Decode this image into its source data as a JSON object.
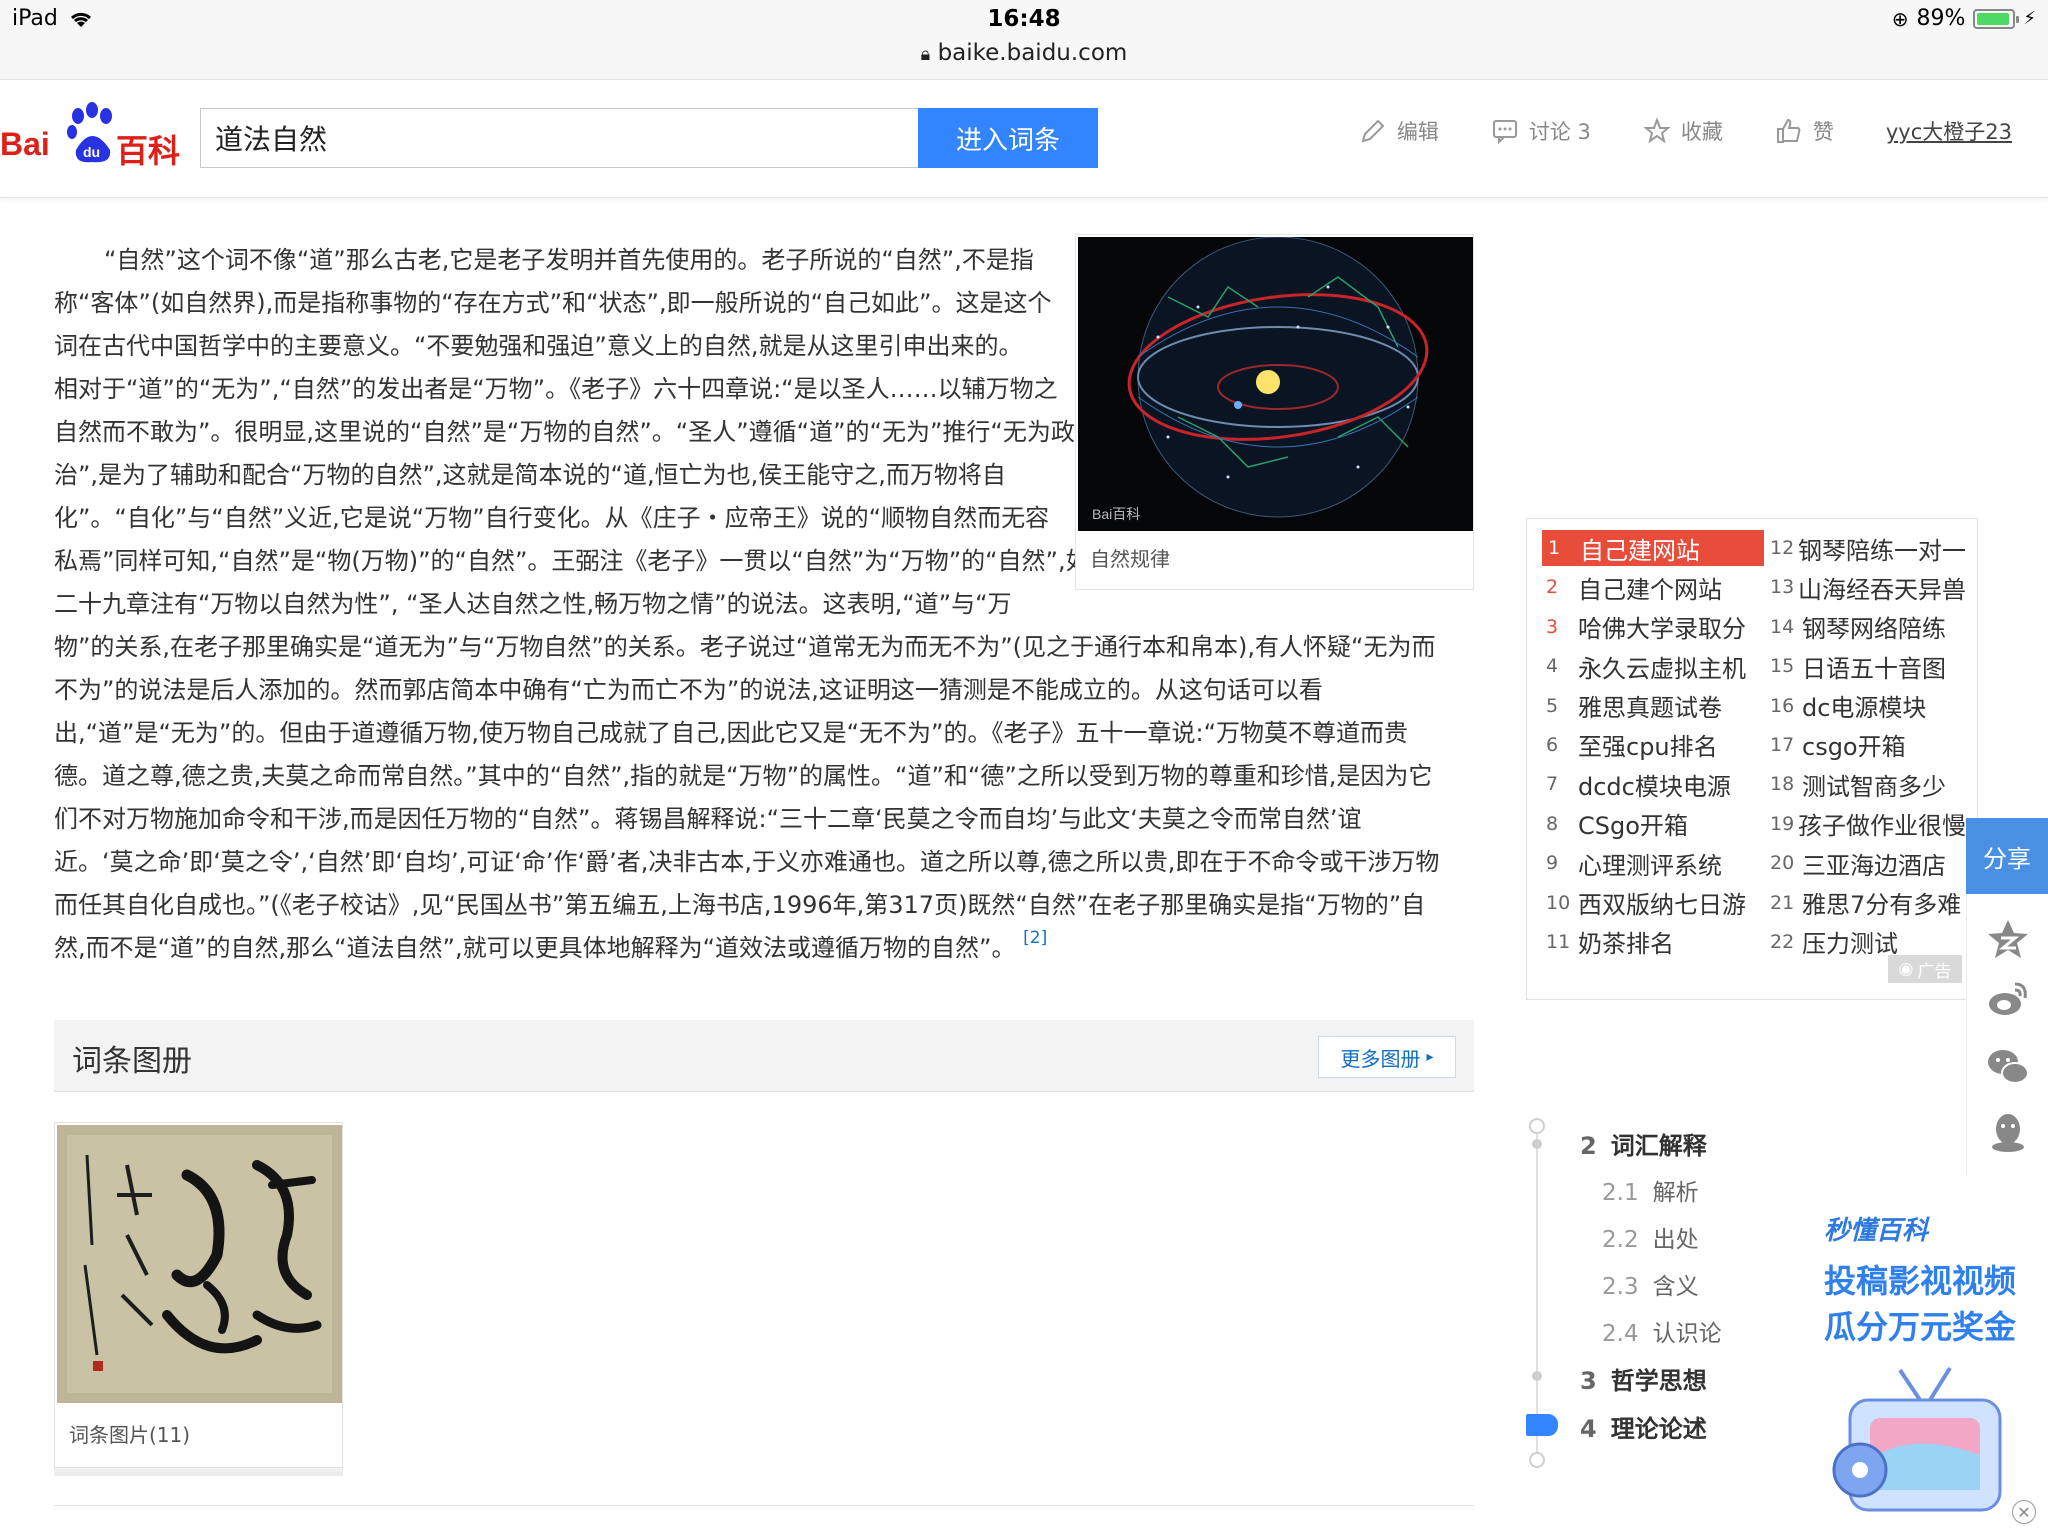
{
  "status": {
    "device": "iPad",
    "time": "16:48",
    "battery": "89%",
    "url": "baike.baidu.com"
  },
  "header": {
    "logo_bai": "Bai",
    "logo_du": "du",
    "logo_baike": "百科",
    "search_value": "道法自然",
    "search_button": "进入词条",
    "edit": "编辑",
    "discuss": "讨论 3",
    "collect": "收藏",
    "like": "赞",
    "user": "yyc大橙子23"
  },
  "article": {
    "lines": [
      "“自然”这个词不像“道”那么古老,它是老子发明并首先使用的。老子所说的“自然”,不是指",
      "称“客体”(如自然界),而是指称事物的“存在方式”和“状态”,即一般所说的“自己如此”。这是这个",
      "词在古代中国哲学中的主要意义。“不要勉强和强迫”意义上的自然,就是从这里引申出来的。",
      "相对于“道”的“无为”,“自然”的发出者是“万物”。《老子》六十四章说:“是以圣人……以辅万物之",
      "自然而不敢为”。很明显,这里说的“自然”是“万物的自然”。“圣人”遵循“道”的“无为”推行“无为政",
      "治”,是为了辅助和配合“万物的自然”,这就是简本说的“道,恒亡为也,侯王能守之,而万物将自",
      "化”。“自化”与“自然”义近,它是说“万物”自行变化。从《庄子・应帝王》说的“顺物自然而无容",
      "私焉”同样可知,“自然”是“物(万物)”的“自然”。王弼注《老子》一贯以“自然”为“万物”的“自然”,如",
      "二十九章注有“万物以自然为性”, “圣人达自然之性,畅万物之情”的说法。这表明,“道”与“万",
      "物”的关系,在老子那里确实是“道无为”与“万物自然”的关系。老子说过“道常无为而无不为”(见之于通行本和帛本),有人怀疑“无为而",
      "不为”的说法是后人添加的。然而郭店简本中确有“亡为而亡不为”的说法,这证明这一猜测是不能成立的。从这句话可以看",
      "出,“道”是“无为”的。但由于道遵循万物,使万物自己成就了自己,因此它又是“无不为”的。《老子》五十一章说:“万物莫不尊道而贵",
      "德。道之尊,德之贵,夫莫之命而常自然。”其中的“自然”,指的就是“万物”的属性。“道”和“德”之所以受到万物的尊重和珍惜,是因为它",
      "们不对万物施加命令和干涉,而是因任万物的“自然”。蒋锡昌解释说:“三十二章‘民莫之令而自均’与此文‘夫莫之令而常自然’谊",
      "近。‘莫之命’即‘莫之令’,‘自然’即‘自均’,可证‘命’作‘爵’者,决非古本,于义亦难通也。道之所以尊,德之所以贵,即在于不命令或干涉万物",
      "而任其自化自成也。”(《老子校诂》,见“民国丛书”第五编五,上海书店,1996年,第317页)既然“自然”在老子那里确实是指“万物的”自",
      "然,而不是“道”的自然,那么“道法自然”,就可以更具体地解释为“道效法或遵循万物的自然”。"
    ],
    "ref": "[2]",
    "figure_caption": "自然规律",
    "figure_watermark": "Bai百科"
  },
  "gallery": {
    "title": "词条图册",
    "more": "更多图册",
    "thumb_caption": "词条图片(11)"
  },
  "hotlist": {
    "left": [
      {
        "n": "1",
        "t": "自己建网站"
      },
      {
        "n": "2",
        "t": "自己建个网站"
      },
      {
        "n": "3",
        "t": "哈佛大学录取分"
      },
      {
        "n": "4",
        "t": "永久云虚拟主机"
      },
      {
        "n": "5",
        "t": "雅思真题试卷"
      },
      {
        "n": "6",
        "t": "至强cpu排名"
      },
      {
        "n": "7",
        "t": "dcdc模块电源"
      },
      {
        "n": "8",
        "t": "CSgo开箱"
      },
      {
        "n": "9",
        "t": "心理测评系统"
      },
      {
        "n": "10",
        "t": "西双版纳七日游"
      },
      {
        "n": "11",
        "t": "奶茶排名"
      }
    ],
    "right": [
      {
        "n": "12",
        "t": "钢琴陪练一对一"
      },
      {
        "n": "13",
        "t": "山海经吞天异兽"
      },
      {
        "n": "14",
        "t": "钢琴网络陪练"
      },
      {
        "n": "15",
        "t": "日语五十音图"
      },
      {
        "n": "16",
        "t": "dc电源模块"
      },
      {
        "n": "17",
        "t": "csgo开箱"
      },
      {
        "n": "18",
        "t": "测试智商多少"
      },
      {
        "n": "19",
        "t": "孩子做作业很慢"
      },
      {
        "n": "20",
        "t": "三亚海边酒店"
      },
      {
        "n": "21",
        "t": "雅思7分有多难"
      },
      {
        "n": "22",
        "t": "压力测试"
      }
    ],
    "ad_label": "广告"
  },
  "share": {
    "label": "分享"
  },
  "toc": [
    {
      "n": "2",
      "t": "词汇解释",
      "level": 1
    },
    {
      "n": "2.1",
      "t": "解析",
      "level": 2
    },
    {
      "n": "2.2",
      "t": "出处",
      "level": 2
    },
    {
      "n": "2.3",
      "t": "含义",
      "level": 2
    },
    {
      "n": "2.4",
      "t": "认识论",
      "level": 2
    },
    {
      "n": "3",
      "t": "哲学思想",
      "level": 1
    },
    {
      "n": "4",
      "t": "理论论述",
      "level": 1
    }
  ],
  "promo": {
    "brand": "秒懂百科",
    "line1": "投稿影视视频",
    "line2": "瓜分万元奖金"
  },
  "colors": {
    "accent": "#3385ff",
    "hot_red": "#e84d3c",
    "link": "#136ec2"
  }
}
